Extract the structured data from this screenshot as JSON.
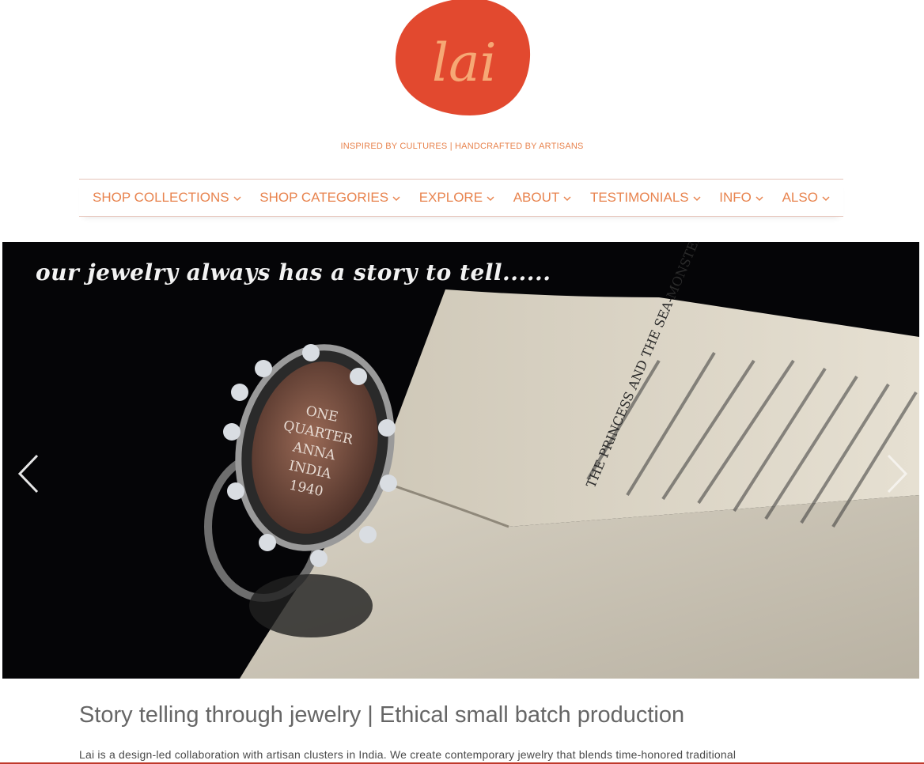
{
  "brand": {
    "logo_text": "lai",
    "tagline": "INSPIRED BY CULTURES | HANDCRAFTED BY ARTISANS",
    "logo_color": "#e2492f",
    "logo_text_color": "#f6a875"
  },
  "nav": {
    "items": [
      {
        "label": "SHOP COLLECTIONS",
        "icon": "chevron-down-icon"
      },
      {
        "label": "SHOP CATEGORIES",
        "icon": "chevron-down-icon"
      },
      {
        "label": "EXPLORE",
        "icon": "chevron-down-icon"
      },
      {
        "label": "ABOUT",
        "icon": "chevron-down-icon"
      },
      {
        "label": "TESTIMONIALS",
        "icon": "chevron-down-icon"
      },
      {
        "label": "INFO",
        "icon": "chevron-down-icon"
      },
      {
        "label": "ALSO",
        "icon": "chevron-down-icon"
      }
    ],
    "color": "#e8844f"
  },
  "hero": {
    "caption": "our jewelry always has a story to tell......",
    "coin_lines": [
      "ONE",
      "QUARTER",
      "ANNA",
      "INDIA",
      "1940"
    ],
    "book_heading": "THE PRINCESS AND THE SEA-MONSTER",
    "prev_icon": "chevron-left-icon",
    "next_icon": "chevron-right-icon"
  },
  "content": {
    "heading": "Story telling through jewelry | Ethical small batch production",
    "intro": "Lai is a design-led collaboration with artisan clusters in India. We create contemporary jewelry that blends time-honored traditional"
  },
  "colors": {
    "accent": "#e8844f",
    "divider": "#e6c3b8",
    "bottom_rule": "#c0392b"
  }
}
